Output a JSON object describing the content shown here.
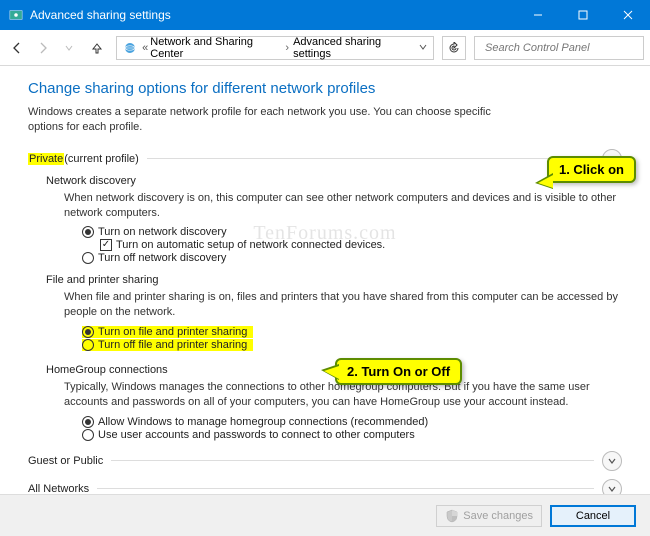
{
  "window": {
    "title": "Advanced sharing settings"
  },
  "breadcrumb": {
    "item1": "Network and Sharing Center",
    "item2": "Advanced sharing settings"
  },
  "search": {
    "placeholder": "Search Control Panel"
  },
  "page": {
    "title": "Change sharing options for different network profiles",
    "description": "Windows creates a separate network profile for each network you use. You can choose specific options for each profile."
  },
  "sections": {
    "private": {
      "label": "Private",
      "suffix": " (current profile)",
      "network_discovery": {
        "title": "Network discovery",
        "desc": "When network discovery is on, this computer can see other network computers and devices and is visible to other network computers.",
        "opt_on": "Turn on network discovery",
        "opt_auto": "Turn on automatic setup of network connected devices.",
        "opt_off": "Turn off network discovery"
      },
      "file_printer": {
        "title": "File and printer sharing",
        "desc": "When file and printer sharing is on, files and printers that you have shared from this computer can be accessed by people on the network.",
        "opt_on": "Turn on file and printer sharing",
        "opt_off": "Turn off file and printer sharing"
      },
      "homegroup": {
        "title": "HomeGroup connections",
        "desc": "Typically, Windows manages the connections to other homegroup computers. But if you have the same user accounts and passwords on all of your computers, you can have HomeGroup use your account instead.",
        "opt_allow": "Allow Windows to manage homegroup connections (recommended)",
        "opt_user": "Use user accounts and passwords to connect to other computers"
      }
    },
    "guest": {
      "label": "Guest or Public"
    },
    "all": {
      "label": "All Networks"
    }
  },
  "buttons": {
    "save": "Save changes",
    "cancel": "Cancel"
  },
  "callouts": {
    "c1": "1. Click on",
    "c2": "2. Turn On or Off"
  },
  "watermark": "TenForums.com"
}
